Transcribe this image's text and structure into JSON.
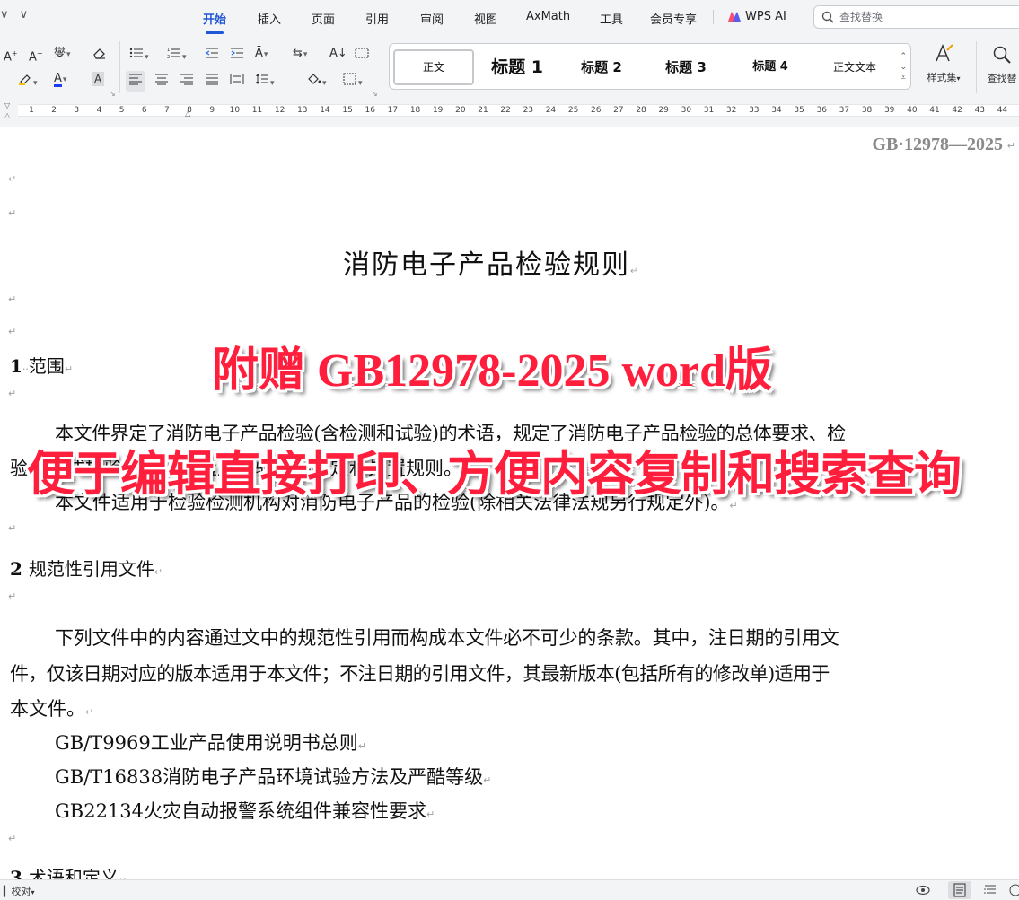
{
  "menu": {
    "left_icons": [
      "∨",
      "∨"
    ],
    "tabs": [
      {
        "label": "开始",
        "active": true
      },
      {
        "label": "插入"
      },
      {
        "label": "页面"
      },
      {
        "label": "引用"
      },
      {
        "label": "审阅"
      },
      {
        "label": "视图"
      },
      {
        "label": "AxMath"
      },
      {
        "label": "工具"
      },
      {
        "label": "会员专享"
      },
      {
        "label": "WPS AI"
      }
    ],
    "search_placeholder": "查找替换"
  },
  "ribbon": {
    "font_row1": [
      "A⁺",
      "A⁻",
      "wén",
      "⌫"
    ],
    "para_buttons_row1": [
      "☰",
      "☰",
      "⇤",
      "⇥",
      "A",
      "⇆",
      "A↓",
      "▭"
    ],
    "styles": [
      {
        "label": "正文",
        "selected": true
      },
      {
        "label": "标题 1"
      },
      {
        "label": "标题 2"
      },
      {
        "label": "标题 3"
      },
      {
        "label": "标题 4"
      },
      {
        "label": "正文文本"
      }
    ],
    "styles_set_label": "样式集",
    "find_label": "查找替"
  },
  "ruler": {
    "numbers": [
      "1",
      "2",
      "3",
      "4",
      "5",
      "6",
      "7",
      "8",
      "9",
      "10",
      "11",
      "12",
      "13",
      "14",
      "15",
      "16",
      "17",
      "18",
      "19",
      "20",
      "21",
      "22",
      "23",
      "24",
      "25",
      "26",
      "27",
      "28",
      "29",
      "30",
      "31",
      "32",
      "33",
      "34",
      "35",
      "36",
      "37",
      "38",
      "39",
      "40",
      "41",
      "42",
      "43",
      "44"
    ]
  },
  "document": {
    "header_code": "GB·12978—2025",
    "title": "消防电子产品检验规则",
    "para_mark": "↵",
    "sections": [
      {
        "num": "1",
        "title": "范围"
      },
      {
        "num": "2",
        "title": "规范性引用文件"
      },
      {
        "num": "3",
        "title": "术语和定义"
      }
    ],
    "scope_lines": [
      "本文件界定了消防电子产品检验(含检测和试验)的术语，规定了消防电子产品检验的总体要求、检",
      "验、型式检验、出厂检验及检验结果判定和处置规则。",
      "本文件适用于检验检测机构对消防电子产品的检验(除相关法律法规另行规定外)。"
    ],
    "norm_lines": [
      "下列文件中的内容通过文中的规范性引用而构成本文件必不可少的条款。其中，注日期的引用文",
      "件，仅该日期对应的版本适用于本文件；不注日期的引用文件，其最新版本(包括所有的修改单)适用于",
      "本文件。"
    ],
    "references": [
      "GB/T9969工业产品使用说明书总则",
      "GB/T16838消防电子产品环境试验方法及严酷等级",
      "GB22134火灾自动报警系统组件兼容性要求"
    ]
  },
  "promo": {
    "line1": "附赠 GB12978-2025 word版",
    "line2": "便于编辑直接打印、方便内容复制和搜索查询"
  },
  "status": {
    "proof_label": "校对"
  }
}
